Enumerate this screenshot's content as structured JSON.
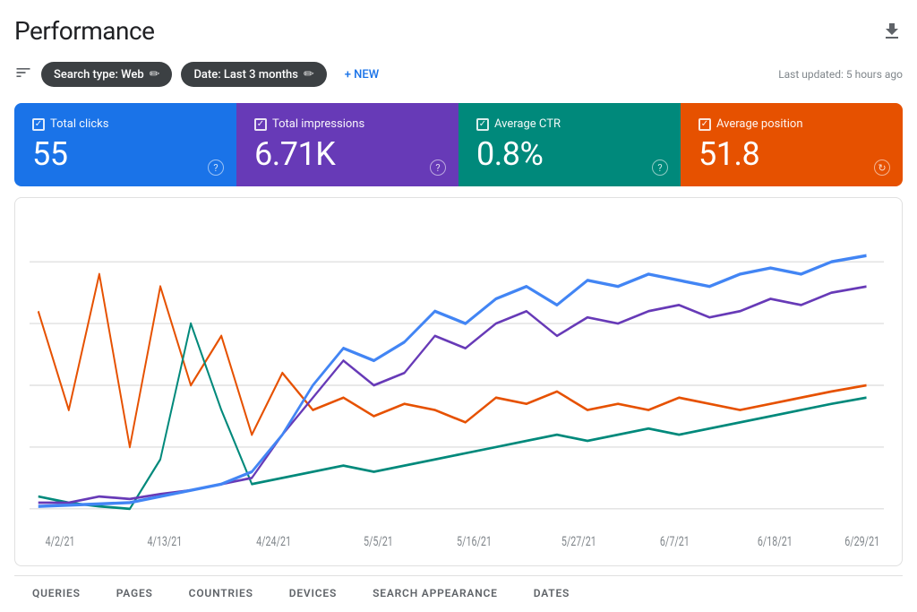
{
  "page": {
    "title": "Performance",
    "last_updated": "Last updated: 5 hours ago"
  },
  "filter_bar": {
    "filter_icon": "≡",
    "chips": [
      {
        "label": "Search type: Web",
        "key": "search-type-chip"
      },
      {
        "label": "Date: Last 3 months",
        "key": "date-chip"
      }
    ],
    "new_button": "+ NEW"
  },
  "metric_cards": [
    {
      "key": "total-clicks",
      "color": "blue",
      "label": "Total clicks",
      "value": "55"
    },
    {
      "key": "total-impressions",
      "color": "purple",
      "label": "Total impressions",
      "value": "6.71K"
    },
    {
      "key": "average-ctr",
      "color": "teal",
      "label": "Average CTR",
      "value": "0.8%"
    },
    {
      "key": "average-position",
      "color": "orange",
      "label": "Average position",
      "value": "51.8"
    }
  ],
  "chart": {
    "x_labels": [
      "4/2/21",
      "4/13/21",
      "4/24/21",
      "5/5/21",
      "5/16/21",
      "5/27/21",
      "6/7/21",
      "6/18/21",
      "6/29/21"
    ],
    "series": {
      "clicks": {
        "color": "#e65100",
        "label": "Total clicks"
      },
      "impressions": {
        "color": "#1a73e8",
        "label": "Total impressions"
      },
      "ctr": {
        "color": "#00897b",
        "label": "Average CTR"
      },
      "position": {
        "color": "#673ab7",
        "label": "Average position"
      }
    }
  },
  "tabs": [
    {
      "label": "QUERIES",
      "active": false
    },
    {
      "label": "PAGES",
      "active": false
    },
    {
      "label": "COUNTRIES",
      "active": false
    },
    {
      "label": "DEVICES",
      "active": false
    },
    {
      "label": "SEARCH APPEARANCE",
      "active": false
    },
    {
      "label": "DATES",
      "active": false
    }
  ]
}
